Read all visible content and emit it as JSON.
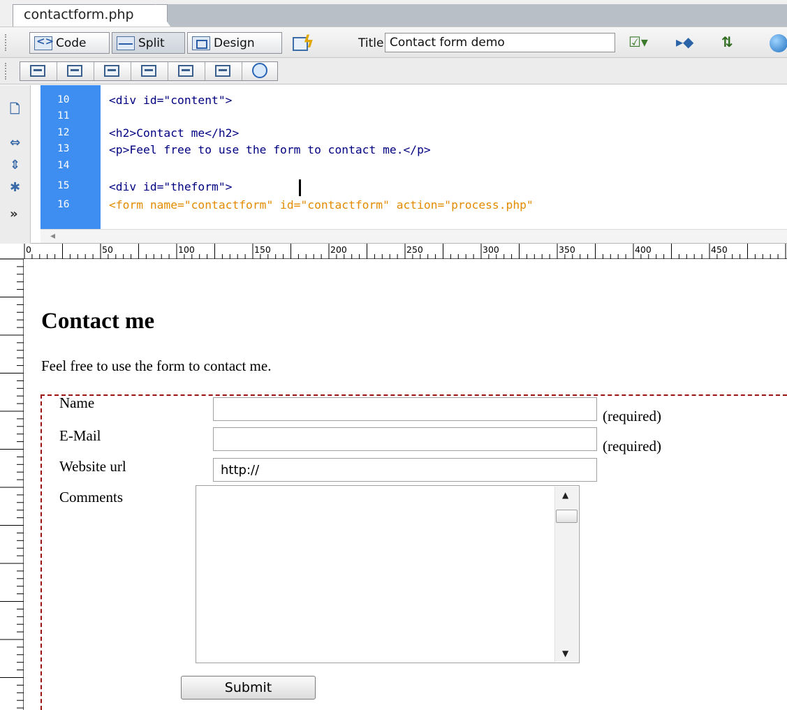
{
  "document_tab": {
    "filename": "contactform.php"
  },
  "toolbar": {
    "code_label": "Code",
    "split_label": "Split",
    "design_label": "Design",
    "title_label": "Title:",
    "title_value": "Contact form demo",
    "active_view": "Split",
    "icons": [
      "code-view-icon",
      "split-view-icon",
      "design-view-icon",
      "live-view-icon",
      "validate-icon",
      "browser-check-icon",
      "file-management-icon",
      "preview-in-browser-icon"
    ]
  },
  "code": {
    "lines": [
      {
        "num": "10",
        "text": "<div id=\"content\">",
        "kind": "tag"
      },
      {
        "num": "11",
        "text": "",
        "kind": "tag"
      },
      {
        "num": "12",
        "text": "<h2>Contact me</h2>",
        "kind": "tag"
      },
      {
        "num": "13",
        "text": "<p>Feel free to use the form to contact me.</p>",
        "kind": "tag"
      },
      {
        "num": "14",
        "text": "",
        "kind": "tag"
      },
      {
        "num": "15",
        "text": "<div id=\"theform\">",
        "kind": "tag"
      },
      {
        "num": "16",
        "text": "<form name=\"contactform\" id=\"contactform\" action=\"process.php\" ",
        "kind": "form"
      }
    ],
    "colors": {
      "gutter": "#3d8ef0",
      "tag": "#000080",
      "form": "#e38b00"
    }
  },
  "ruler": {
    "ticks": [
      "0",
      "50",
      "100",
      "150",
      "200",
      "250",
      "300",
      "350",
      "400",
      "450"
    ]
  },
  "page": {
    "heading": "Contact me",
    "intro": "Feel free to use the form to contact me."
  },
  "form": {
    "fields": {
      "name_label": "Name",
      "email_label": "E-Mail",
      "website_label": "Website url",
      "website_value": "http://",
      "comments_label": "Comments",
      "required_hint": "(required)"
    },
    "submit_label": "Submit",
    "border_color": "#9a1212"
  }
}
